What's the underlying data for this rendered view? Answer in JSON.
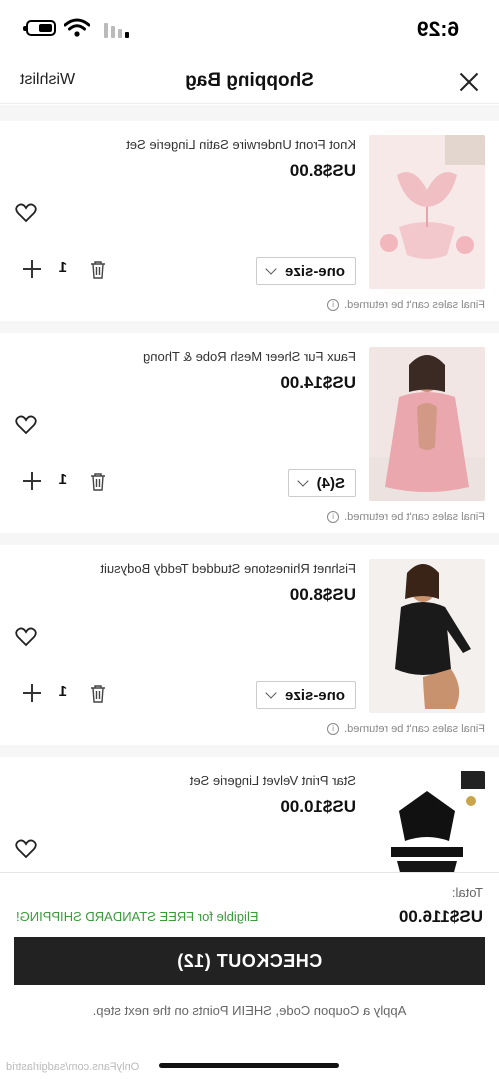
{
  "status_bar": {
    "time": "6:29"
  },
  "header": {
    "title": "Shopping Bag",
    "wishlist_label": "Wishlist"
  },
  "items": [
    {
      "title": "Knot Front Underwire Satin Lingerie Set",
      "price": "US$8.00",
      "size": "one-size",
      "quantity": "1",
      "note": "Final sales can't be returned.",
      "thumb_colors": [
        "#f6dede",
        "#f0bfc4",
        "#e8e0db"
      ]
    },
    {
      "title": "Faux Fur Sheer Mesh Robe & Thong",
      "price": "US$14.00",
      "size": "S(4)",
      "quantity": "1",
      "note": "Final sales can't be returned.",
      "thumb_colors": [
        "#f3e4e2",
        "#e9a9ae",
        "#c98f7a"
      ]
    },
    {
      "title": "Fishnet Rhinestone Studded Teddy Bodysuit",
      "price": "US$8.00",
      "size": "one-size",
      "quantity": "1",
      "note": "Final sales can't be returned.",
      "thumb_colors": [
        "#f4f0ee",
        "#1a1a1a",
        "#c9926f"
      ]
    },
    {
      "title": "Star Print Velvet Lingerie Set",
      "price": "US$10.00",
      "thumb_colors": [
        "#ffffff",
        "#111111",
        "#c9a44b"
      ]
    }
  ],
  "footer": {
    "total_label": "Total:",
    "total_amount": "US$116.00",
    "free_shipping": "Eligible for FREE STANDARD SHIPPING!",
    "checkout_label": "CHECKOUT (12)",
    "coupon_note": "Apply a Coupon Code, SHEIN Points on the next step.",
    "watermark": "OnlyFans.com/sadgirlastrid"
  },
  "colors": {
    "checkout_bg": "#222222",
    "free_shipping": "#3a9b3a",
    "separator": "#f6f6f6"
  },
  "icons": [
    "close-icon",
    "heart-icon",
    "trash-icon",
    "plus-icon",
    "chevron-down-icon",
    "info-icon",
    "wifi-icon",
    "battery-icon",
    "signal-icon"
  ]
}
